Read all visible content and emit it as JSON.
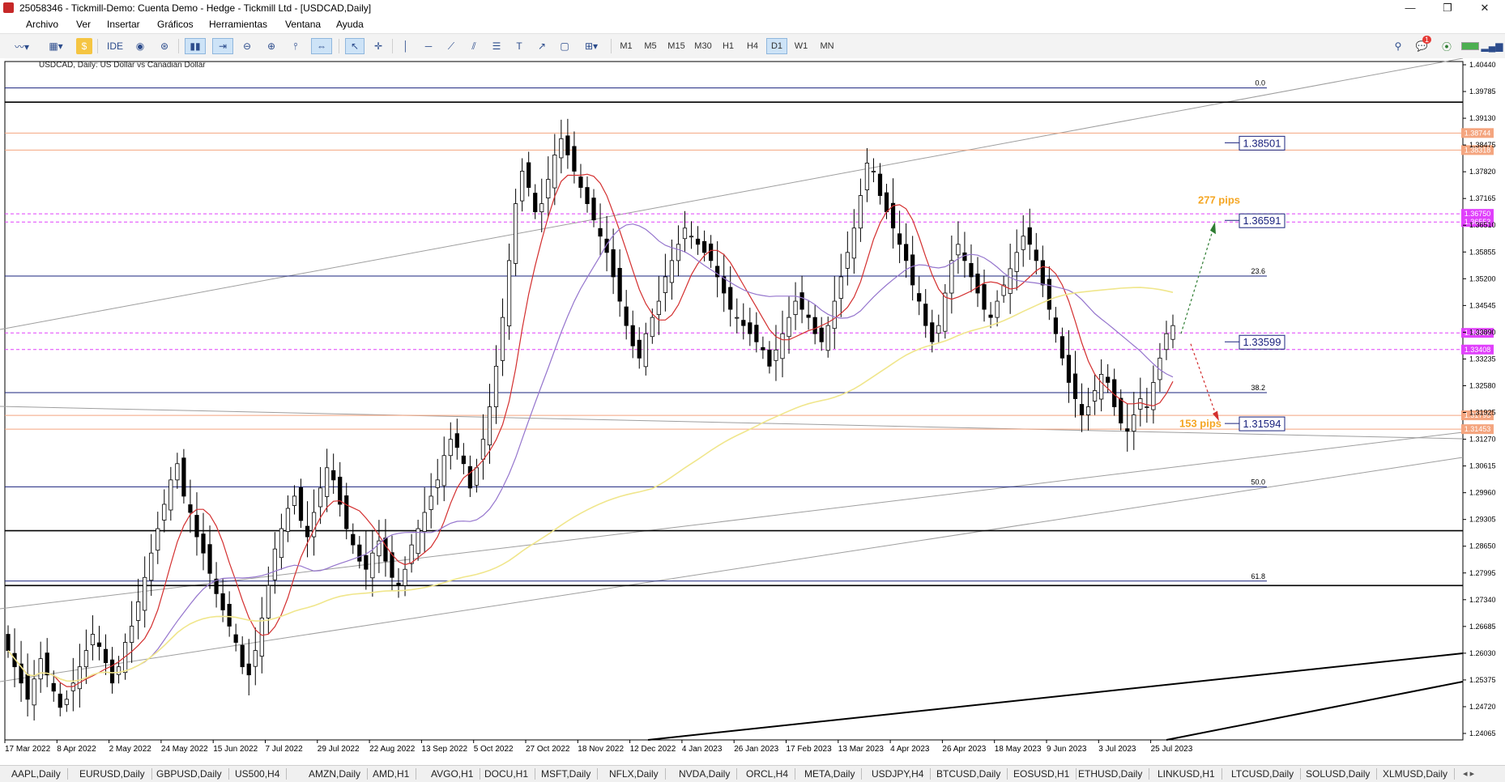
{
  "window": {
    "title": "25058346 - Tickmill-Demo: Cuenta Demo - Hedge - Tickmill Ltd - [USDCAD,Daily]",
    "controls": [
      "—",
      "❐",
      "✕"
    ]
  },
  "menu": [
    "Archivo",
    "Ver",
    "Insertar",
    "Gráficos",
    "Herramientas",
    "Ventana",
    "Ayuda"
  ],
  "toolbar": {
    "ide": "IDE",
    "timeframes": [
      "M1",
      "M5",
      "M15",
      "M30",
      "H1",
      "H4",
      "D1",
      "W1",
      "MN"
    ],
    "active_timeframe": "D1",
    "notifications": "1"
  },
  "chart_data": {
    "type": "candlestick",
    "symbol_label": "USDCAD, Daily:  US Dollar vs Canadian Dollar",
    "y_ticks": [
      "1.40440",
      "1.39785",
      "1.39130",
      "1.38475",
      "1.37820",
      "1.37165",
      "1.36510",
      "1.35855",
      "1.35200",
      "1.34545",
      "1.33890",
      "1.33235",
      "1.32580",
      "1.31925",
      "1.31270",
      "1.30615",
      "1.29960",
      "1.29305",
      "1.28650",
      "1.27995",
      "1.27340",
      "1.26685",
      "1.26030",
      "1.25375",
      "1.24720",
      "1.24065"
    ],
    "x_ticks": [
      "17 Mar 2022",
      "8 Apr 2022",
      "2 May 2022",
      "24 May 2022",
      "15 Jun 2022",
      "7 Jul 2022",
      "29 Jul 2022",
      "22 Aug 2022",
      "13 Sep 2022",
      "5 Oct 2022",
      "27 Oct 2022",
      "18 Nov 2022",
      "12 Dec 2022",
      "4 Jan 2023",
      "26 Jan 2023",
      "17 Feb 2023",
      "13 Mar 2023",
      "4 Apr 2023",
      "26 Apr 2023",
      "18 May 2023",
      "9 Jun 2023",
      "3 Jul 2023",
      "25 Jul 2023"
    ],
    "ylim": [
      1.238,
      1.405
    ],
    "candles_close": [
      1.26,
      1.256,
      1.252,
      1.248,
      1.253,
      1.258,
      1.254,
      1.25,
      1.246,
      1.248,
      1.252,
      1.256,
      1.26,
      1.264,
      1.261,
      1.257,
      1.252,
      1.256,
      1.262,
      1.266,
      1.272,
      1.278,
      1.284,
      1.29,
      1.296,
      1.302,
      1.306,
      1.298,
      1.294,
      1.288,
      1.284,
      1.279,
      1.274,
      1.27,
      1.266,
      1.262,
      1.256,
      1.254,
      1.26,
      1.268,
      1.276,
      1.285,
      1.29,
      1.295,
      1.298,
      1.292,
      1.288,
      1.294,
      1.3,
      1.305,
      1.302,
      1.296,
      1.29,
      1.286,
      1.282,
      1.28,
      1.284,
      1.287,
      1.282,
      1.278,
      1.276,
      1.28,
      1.286,
      1.29,
      1.294,
      1.298,
      1.302,
      1.308,
      1.312,
      1.31,
      1.306,
      1.3,
      1.305,
      1.312,
      1.32,
      1.33,
      1.342,
      1.356,
      1.37,
      1.378,
      1.374,
      1.368,
      1.37,
      1.376,
      1.382,
      1.386,
      1.382,
      1.378,
      1.374,
      1.37,
      1.366,
      1.362,
      1.358,
      1.352,
      1.346,
      1.34,
      1.335,
      1.332,
      1.338,
      1.342,
      1.346,
      1.352,
      1.356,
      1.36,
      1.364,
      1.362,
      1.36,
      1.358,
      1.356,
      1.352,
      1.348,
      1.344,
      1.342,
      1.34,
      1.338,
      1.336,
      1.334,
      1.33,
      1.334,
      1.338,
      1.342,
      1.346,
      1.344,
      1.342,
      1.338,
      1.336,
      1.34,
      1.346,
      1.352,
      1.358,
      1.364,
      1.372,
      1.38,
      1.378,
      1.372,
      1.368,
      1.364,
      1.36,
      1.356,
      1.35,
      1.346,
      1.34,
      1.336,
      1.34,
      1.348,
      1.356,
      1.36,
      1.356,
      1.352,
      1.348,
      1.344,
      1.342,
      1.346,
      1.35,
      1.354,
      1.358,
      1.362,
      1.36,
      1.356,
      1.35,
      1.344,
      1.338,
      1.332,
      1.326,
      1.322,
      1.318,
      1.32,
      1.324,
      1.328,
      1.326,
      1.32,
      1.316,
      1.314,
      1.318,
      1.322,
      1.32,
      1.326,
      1.332,
      1.338,
      1.34
    ],
    "moving_averages": [
      {
        "color": "#d32f2f"
      },
      {
        "color": "#9575cd"
      },
      {
        "color": "#f0e68c"
      }
    ],
    "fib_levels": [
      {
        "label": "0.0",
        "price": 1.3985
      },
      {
        "label": "23.6",
        "price": 1.3522
      },
      {
        "label": "38.2",
        "price": 1.3235
      },
      {
        "label": "50.0",
        "price": 1.3003
      },
      {
        "label": "61.8",
        "price": 1.2771
      }
    ],
    "price_boxes": [
      {
        "label": "1.38501",
        "price": 1.385
      },
      {
        "label": "1.36591",
        "price": 1.3659
      },
      {
        "label": "1.33599",
        "price": 1.336
      },
      {
        "label": "1.31594",
        "price": 1.3159
      }
    ],
    "right_price_tags": [
      {
        "label": "1.38744",
        "price": 1.3874,
        "color": "#f4a57f"
      },
      {
        "label": "1.38318",
        "price": 1.3832,
        "color": "#f4a57f"
      },
      {
        "label": "1.36750",
        "price": 1.3675,
        "color": "#e040fb"
      },
      {
        "label": "1.36553",
        "price": 1.3655,
        "color": "#e040fb"
      },
      {
        "label": "1.33822",
        "price": 1.3382,
        "color": "#e040fb"
      },
      {
        "label": "1.33408",
        "price": 1.3341,
        "color": "#e040fb"
      },
      {
        "label": "1.31793",
        "price": 1.3179,
        "color": "#f4a57f"
      },
      {
        "label": "1.31453",
        "price": 1.3145,
        "color": "#f4a57f"
      }
    ],
    "annotations": [
      {
        "label": "277 pips",
        "color": "#f5a623"
      },
      {
        "label": "153 pips",
        "color": "#f5a623"
      }
    ]
  },
  "tabs": [
    "AAPL,Daily",
    "EURUSD,Daily",
    "GBPUSD,Daily",
    "US500,H4",
    "AMZN,Daily",
    "AMD,H1",
    "AVGO,H1",
    "DOCU,H1",
    "MSFT,Daily",
    "NFLX,Daily",
    "NVDA,Daily",
    "ORCL,H4",
    "META,Daily",
    "USDJPY,H4",
    "BTCUSD,Daily",
    "EOSUSD,H1",
    "ETHUSD,Daily",
    "LINKUSD,H1",
    "LTCUSD,Daily",
    "SOLUSD,Daily",
    "XLMUSD,Daily"
  ]
}
